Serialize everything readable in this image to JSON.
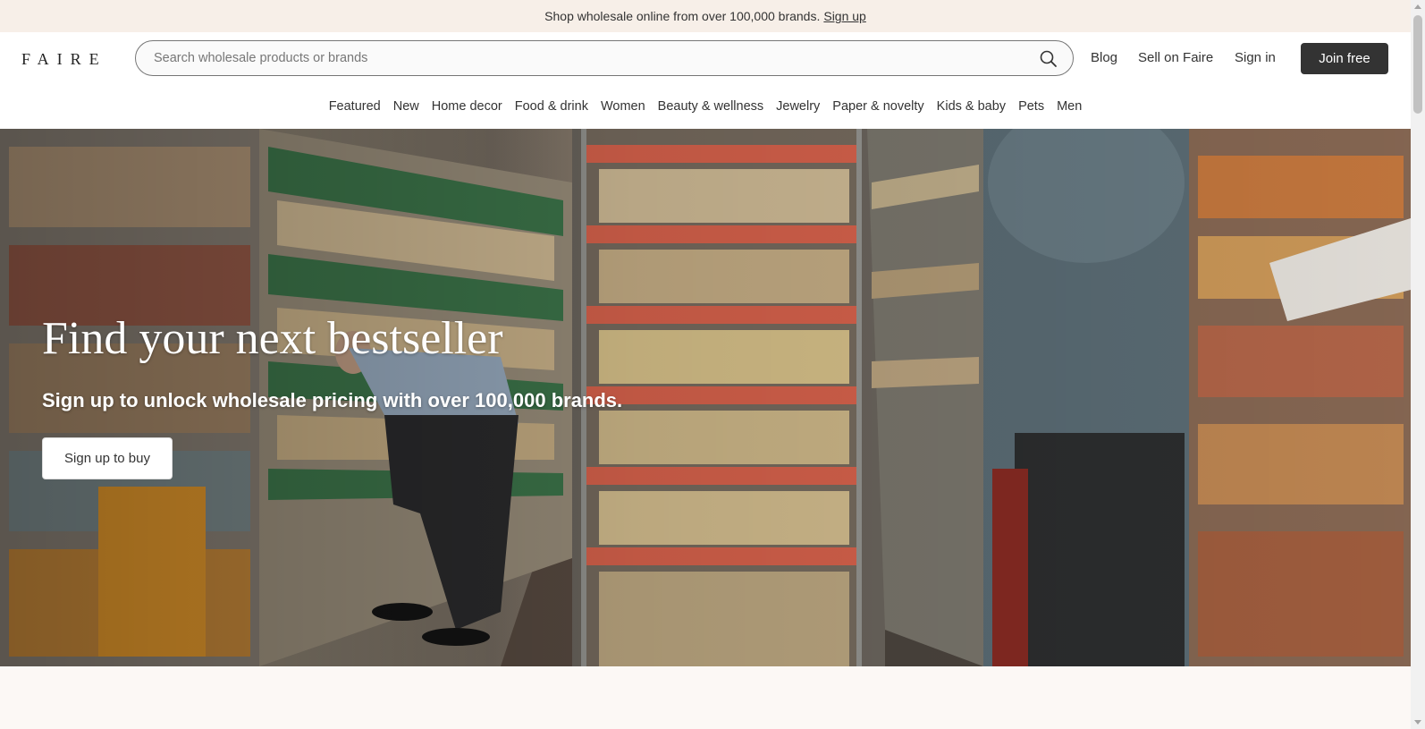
{
  "announcement": {
    "text": "Shop wholesale online from over 100,000 brands.",
    "link": "Sign up"
  },
  "header": {
    "logo": "FAIRE",
    "search_placeholder": "Search wholesale products or brands",
    "links": {
      "blog": "Blog",
      "sell": "Sell on Faire",
      "signin": "Sign in"
    },
    "join_button": "Join free"
  },
  "categories": [
    "Featured",
    "New",
    "Home decor",
    "Food & drink",
    "Women",
    "Beauty & wellness",
    "Jewelry",
    "Paper & novelty",
    "Kids & baby",
    "Pets",
    "Men"
  ],
  "hero": {
    "title": "Find your next bestseller",
    "subtitle": "Sign up to unlock wholesale pricing with over 100,000 brands.",
    "button": "Sign up to buy"
  },
  "colors": {
    "announce_bg": "#f7efe8",
    "page_bg": "#fcf8f5",
    "button_dark": "#333333",
    "shelf_accent": "#e0664f"
  }
}
